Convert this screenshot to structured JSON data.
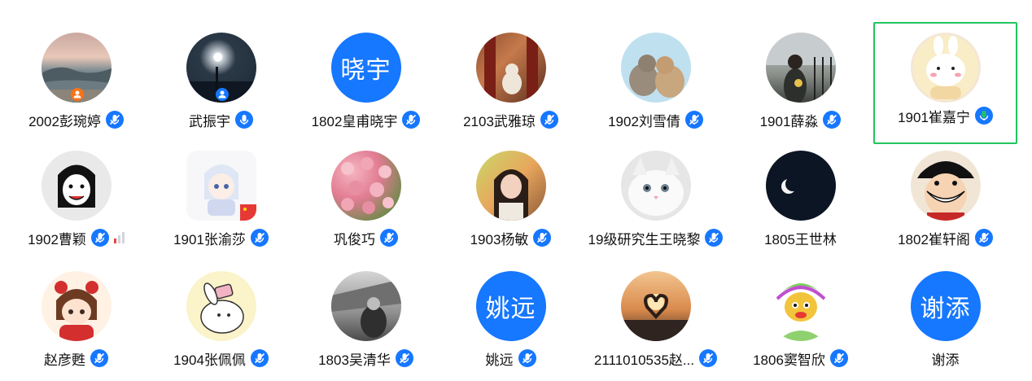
{
  "accent": "#1677ff",
  "selected_color": "#22c55e",
  "participants": [
    {
      "name": "2002彭琬婷",
      "mic": "mic-muted-icon"
    },
    {
      "name": "武振宇",
      "mic": "mic-on-icon"
    },
    {
      "name": "1802皇甫晓宇",
      "mic": "mic-muted-icon",
      "avatar_text": "晓宇"
    },
    {
      "name": "2103武雅琼",
      "mic": "mic-muted-icon"
    },
    {
      "name": "1902刘雪倩",
      "mic": "mic-muted-icon"
    },
    {
      "name": "1901薛淼",
      "mic": "mic-muted-icon"
    },
    {
      "name": "1901崔嘉宁",
      "mic": "mic-speaking-icon",
      "selected": true
    },
    {
      "name": "1902曹颖",
      "mic": "mic-muted-icon"
    },
    {
      "name": "1901张渝莎",
      "mic": "mic-muted-icon"
    },
    {
      "name": "巩俊巧",
      "mic": "mic-muted-icon"
    },
    {
      "name": "1903杨敏",
      "mic": "mic-muted-icon"
    },
    {
      "name": "19级研究生王晓黎",
      "mic": "mic-muted-icon"
    },
    {
      "name": "1805王世林",
      "mic": "none"
    },
    {
      "name": "1802崔轩阁",
      "mic": "mic-muted-icon"
    },
    {
      "name": "赵彦甦",
      "mic": "mic-muted-icon"
    },
    {
      "name": "1904张佩佩",
      "mic": "mic-muted-icon"
    },
    {
      "name": "1803吴清华",
      "mic": "mic-muted-icon"
    },
    {
      "name": "姚远",
      "mic": "mic-muted-icon",
      "avatar_text": "姚远"
    },
    {
      "name": "2111010535赵...",
      "mic": "mic-muted-icon"
    },
    {
      "name": "1806窦智欣",
      "mic": "mic-muted-icon"
    },
    {
      "name": "谢添",
      "mic": "none",
      "avatar_text": "谢添"
    }
  ]
}
